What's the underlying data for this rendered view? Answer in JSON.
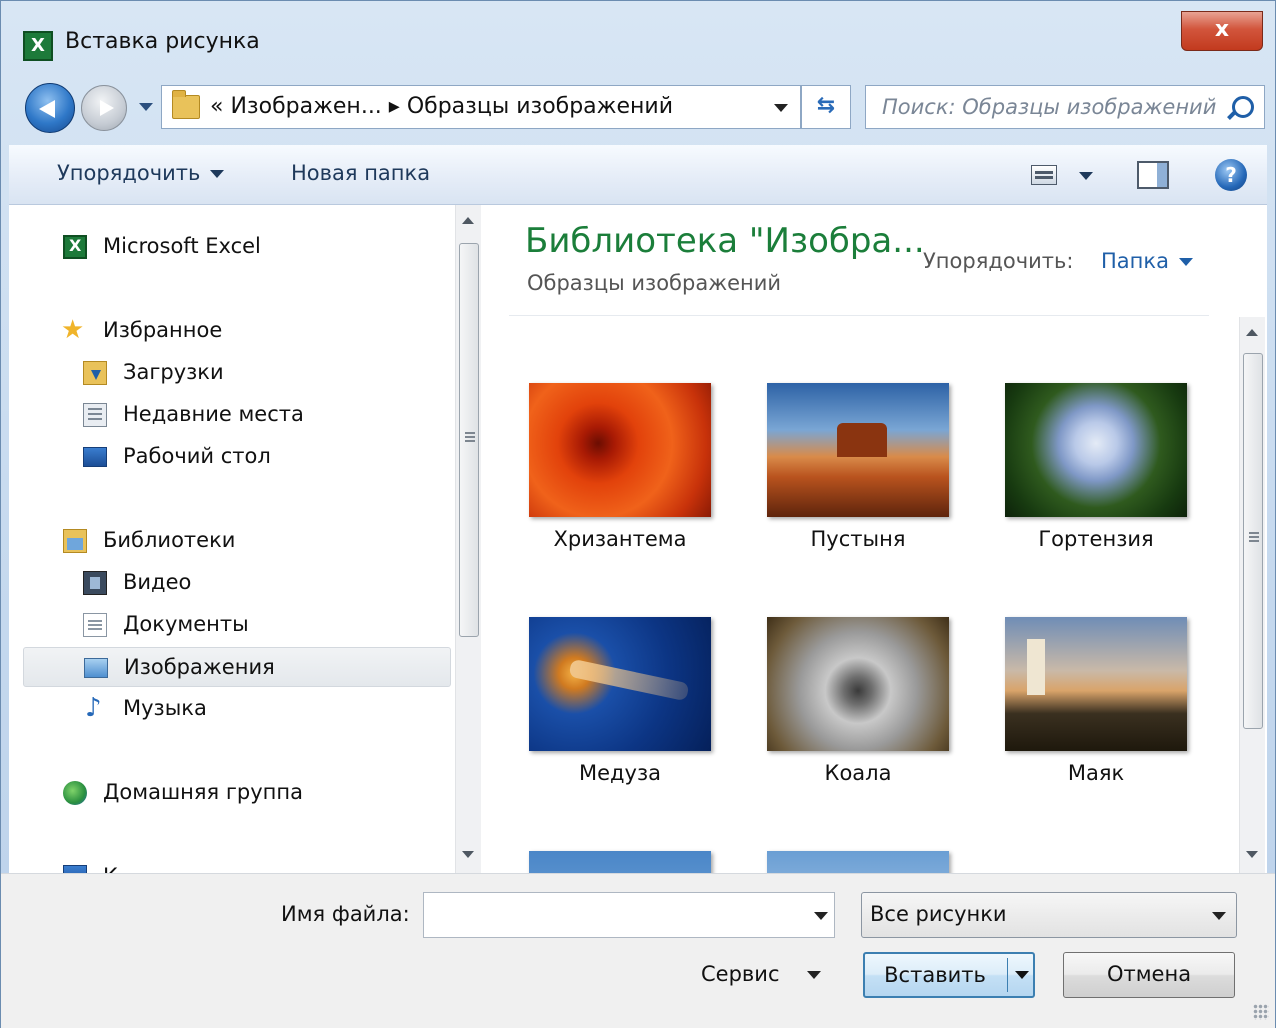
{
  "window": {
    "title": "Вставка рисунка",
    "close_label": "x"
  },
  "navigation": {
    "address_text": "« Изображен... ▸ Образцы изображений",
    "search_placeholder": "Поиск: Образцы изображений"
  },
  "toolbar": {
    "organize_label": "Упорядочить",
    "new_folder_label": "Новая папка",
    "help_label": "?"
  },
  "sidebar": {
    "items": [
      {
        "label": "Microsoft Excel",
        "icon": "excel-icon"
      },
      {
        "label": "Избранное",
        "icon": "star-icon"
      },
      {
        "label": "Загрузки",
        "icon": "downloads-folder-icon"
      },
      {
        "label": "Недавние места",
        "icon": "recent-places-icon"
      },
      {
        "label": "Рабочий стол",
        "icon": "desktop-icon"
      },
      {
        "label": "Библиотеки",
        "icon": "libraries-icon"
      },
      {
        "label": "Видео",
        "icon": "video-icon"
      },
      {
        "label": "Документы",
        "icon": "documents-icon"
      },
      {
        "label": "Изображения",
        "icon": "pictures-icon",
        "selected": true
      },
      {
        "label": "Музыка",
        "icon": "music-icon"
      },
      {
        "label": "Домашняя группа",
        "icon": "homegroup-icon"
      },
      {
        "label": "К",
        "icon": "computer-icon"
      }
    ]
  },
  "main": {
    "library_title": "Библиотека \"Изобра...",
    "library_subtitle": "Образцы изображений",
    "arrange_label": "Упорядочить:",
    "arrange_value": "Папка",
    "files": [
      {
        "name": "Хризантема"
      },
      {
        "name": "Пустыня"
      },
      {
        "name": "Гортензия"
      },
      {
        "name": "Медуза"
      },
      {
        "name": "Коала"
      },
      {
        "name": "Маяк"
      }
    ]
  },
  "footer": {
    "filename_label": "Имя файла:",
    "filename_value": "",
    "filetype_value": "Все рисунки",
    "tools_label": "Сервис",
    "insert_label": "Вставить",
    "cancel_label": "Отмена"
  },
  "colors": {
    "library_title": "#1b7e3a",
    "link_blue": "#1f5fa8",
    "close_red": "#c23a1e"
  }
}
